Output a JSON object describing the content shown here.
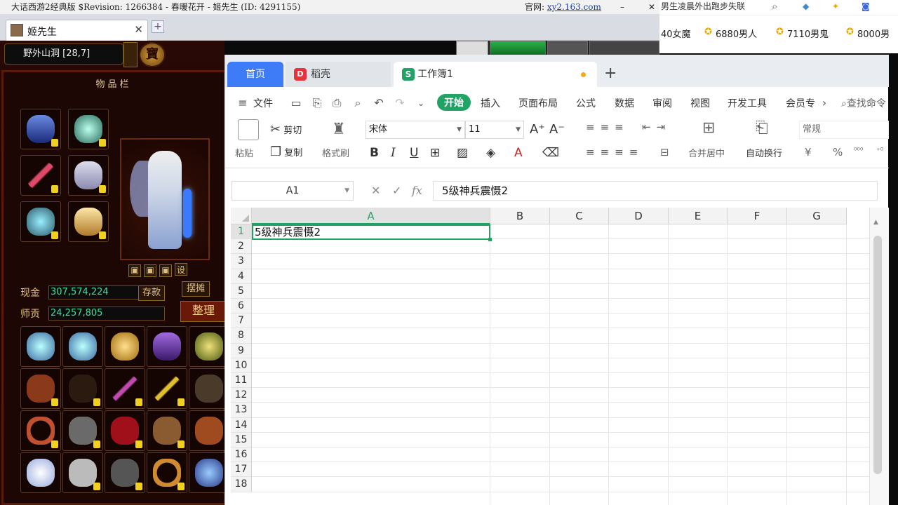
{
  "game_window": {
    "title": "大话西游2经典版 $Revision: 1266384 - 春暖花开 - 姬先生 (ID: 4291155)",
    "site_label": "官网:",
    "site_link": "xy2.163.com",
    "min_btn": "–",
    "close_btn": "✕",
    "tab_label": "姬先生",
    "tab_close": "✕",
    "newtab": "+"
  },
  "game": {
    "location": "野外山洞 [28,7]",
    "crest": "寶",
    "panel_title": "物品栏",
    "money_label": "现金",
    "money_value": "307,574,224",
    "deposit_btn": "存款",
    "stall_btn": "摆摊",
    "merit_label": "师贡",
    "merit_value": "24,257,805",
    "sort_btn": "整理",
    "settings_btn": "设"
  },
  "browser_strip": {
    "news": "男生凌晨外出跑步失联",
    "tags": [
      {
        "label": "40女魔"
      },
      {
        "label": "6880男人"
      },
      {
        "label": "7110男鬼"
      },
      {
        "label": "8000男"
      }
    ]
  },
  "wps": {
    "tabs": {
      "home": "首页",
      "docer": "稻壳",
      "docer_logo": "D",
      "workbook": "工作簿1",
      "workbook_logo": "S",
      "newtab": "+"
    },
    "menu": {
      "file": "文件",
      "start": "开始",
      "insert": "插入",
      "page_layout": "页面布局",
      "formula": "公式",
      "data": "数据",
      "review": "审阅",
      "view": "视图",
      "dev_tools": "开发工具",
      "member": "会员专",
      "search": "查找命令"
    },
    "ribbon": {
      "paste": "粘贴",
      "cut": "剪切",
      "copy": "复制",
      "format_painter": "格式刷",
      "font_name": "宋体",
      "font_size": "11",
      "merge_center": "合并居中",
      "wrap_text": "自动换行",
      "number_format": "常规",
      "currency": "¥",
      "percent": "%"
    },
    "formula_bar": {
      "name_box": "A1",
      "fx": "fx",
      "content": "5级神兵震慑2"
    },
    "grid": {
      "columns": [
        "A",
        "B",
        "C",
        "D",
        "E",
        "F",
        "G"
      ],
      "rows": [
        "1",
        "2",
        "3",
        "4",
        "5",
        "6",
        "7",
        "8",
        "9",
        "10",
        "11",
        "12",
        "13",
        "14",
        "15",
        "16",
        "17",
        "18"
      ],
      "cell_a1": "5级神兵震慑2"
    }
  }
}
